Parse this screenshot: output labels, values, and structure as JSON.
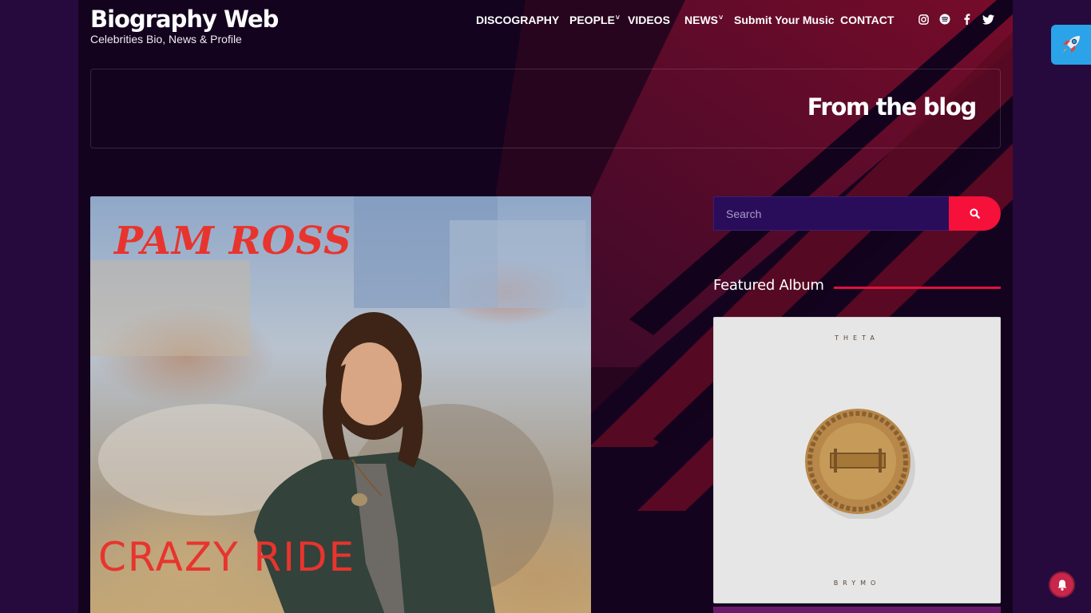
{
  "header": {
    "site_title": "Biography Web",
    "tagline": "Celebrities Bio, News & Profile",
    "nav": [
      {
        "label": "DISCOGRAPHY",
        "dropdown": false
      },
      {
        "label": "PEOPLE",
        "dropdown": true
      },
      {
        "label": "VIDEOS",
        "dropdown": false
      },
      {
        "label": "NEWS",
        "dropdown": true
      },
      {
        "label": "Submit Your Music",
        "dropdown": false
      },
      {
        "label": "CONTACT",
        "dropdown": false
      }
    ],
    "caret": "˅",
    "social_icons": [
      "instagram-icon",
      "spotify-icon",
      "facebook-icon",
      "twitter-icon"
    ]
  },
  "banner": {
    "title": "From the blog"
  },
  "post": {
    "image_artist_text": "PAM ROSS",
    "image_title_text": "CRAZY RIDE"
  },
  "sidebar": {
    "search_placeholder": "Search",
    "featured_title": "Featured Album",
    "album_top_text": "THETA",
    "album_bottom_text": "BRYMO"
  },
  "colors": {
    "accent": "#f5113a",
    "background": "#14031f",
    "outer": "#260a3e",
    "search_bg": "#2a0d5a"
  }
}
